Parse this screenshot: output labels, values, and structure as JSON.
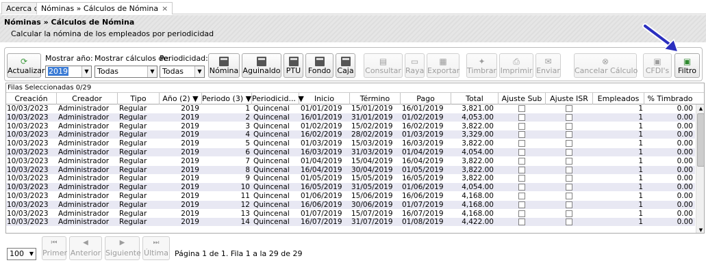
{
  "tabs": [
    {
      "label": "Acerca de"
    },
    {
      "label": "Nóminas » Cálculos de Nómina",
      "close": "×"
    }
  ],
  "header": {
    "title": "Nóminas » Cálculos de Nómina",
    "subtitle": "Calcular la nómina de los empleados por periodicidad"
  },
  "toolbar": {
    "refresh_label": "Actualizar",
    "year_label": "Mostrar año:",
    "year_value": "2019",
    "calc_label": "Mostrar cálculos de:",
    "calc_value": "Todas",
    "period_label": "Periodicidad:",
    "period_value": "Todas",
    "buttons": {
      "nomina": "Nómina",
      "aguinaldo": "Aguinaldo",
      "ptu": "PTU",
      "fondo": "Fondo",
      "caja": "Caja",
      "consultar": "Consultar",
      "raya": "Raya",
      "exportar": "Exportar",
      "timbrar": "Timbrar",
      "imprimir": "Imprimir",
      "enviar": "Enviar",
      "cancelar": "Cancelar Cálculo",
      "cfdis": "CFDI's",
      "filtro": "Filtro"
    }
  },
  "grid": {
    "selected_rows": "Filas Seleccionadas  0/29",
    "columns": [
      "Creación",
      "Creador",
      "Tipo",
      "Año (2) ▼",
      "Periodo (3) ▼",
      "Periodicid... ▼",
      "Inicio",
      "Término",
      "Pago",
      "Total",
      "Ajuste Sub",
      "Ajuste ISR",
      "Empleados",
      "% Timbrado"
    ],
    "rows": [
      [
        "10/03/2023",
        "Administrador",
        "Regular",
        "2019",
        "1",
        "Quincenal",
        "01/01/2019",
        "15/01/2019",
        "16/01/2019",
        "3,821.00",
        "1",
        "0.00"
      ],
      [
        "10/03/2023",
        "Administrador",
        "Regular",
        "2019",
        "2",
        "Quincenal",
        "16/01/2019",
        "31/01/2019",
        "01/02/2019",
        "4,053.00",
        "1",
        "0.00"
      ],
      [
        "10/03/2023",
        "Administrador",
        "Regular",
        "2019",
        "3",
        "Quincenal",
        "01/02/2019",
        "15/02/2019",
        "16/02/2019",
        "3,822.00",
        "1",
        "0.00"
      ],
      [
        "10/03/2023",
        "Administrador",
        "Regular",
        "2019",
        "4",
        "Quincenal",
        "16/02/2019",
        "28/02/2019",
        "01/03/2019",
        "3,329.00",
        "1",
        "0.00"
      ],
      [
        "10/03/2023",
        "Administrador",
        "Regular",
        "2019",
        "5",
        "Quincenal",
        "01/03/2019",
        "15/03/2019",
        "16/03/2019",
        "3,822.00",
        "1",
        "0.00"
      ],
      [
        "10/03/2023",
        "Administrador",
        "Regular",
        "2019",
        "6",
        "Quincenal",
        "16/03/2019",
        "31/03/2019",
        "01/04/2019",
        "4,054.00",
        "1",
        "0.00"
      ],
      [
        "10/03/2023",
        "Administrador",
        "Regular",
        "2019",
        "7",
        "Quincenal",
        "01/04/2019",
        "15/04/2019",
        "16/04/2019",
        "3,822.00",
        "1",
        "0.00"
      ],
      [
        "10/03/2023",
        "Administrador",
        "Regular",
        "2019",
        "8",
        "Quincenal",
        "16/04/2019",
        "30/04/2019",
        "01/05/2019",
        "3,822.00",
        "1",
        "0.00"
      ],
      [
        "10/03/2023",
        "Administrador",
        "Regular",
        "2019",
        "9",
        "Quincenal",
        "01/05/2019",
        "15/05/2019",
        "16/05/2019",
        "3,822.00",
        "1",
        "0.00"
      ],
      [
        "10/03/2023",
        "Administrador",
        "Regular",
        "2019",
        "10",
        "Quincenal",
        "16/05/2019",
        "31/05/2019",
        "01/06/2019",
        "4,054.00",
        "1",
        "0.00"
      ],
      [
        "10/03/2023",
        "Administrador",
        "Regular",
        "2019",
        "11",
        "Quincenal",
        "01/06/2019",
        "15/06/2019",
        "16/06/2019",
        "4,168.00",
        "1",
        "0.00"
      ],
      [
        "10/03/2023",
        "Administrador",
        "Regular",
        "2019",
        "12",
        "Quincenal",
        "16/06/2019",
        "30/06/2019",
        "01/07/2019",
        "4,168.00",
        "1",
        "0.00"
      ],
      [
        "10/03/2023",
        "Administrador",
        "Regular",
        "2019",
        "13",
        "Quincenal",
        "01/07/2019",
        "15/07/2019",
        "16/07/2019",
        "4,168.00",
        "1",
        "0.00"
      ],
      [
        "10/03/2023",
        "Administrador",
        "Regular",
        "2019",
        "14",
        "Quincenal",
        "16/07/2019",
        "31/07/2019",
        "01/08/2019",
        "4,422.00",
        "1",
        "0.00"
      ]
    ]
  },
  "pager": {
    "page_size": "100",
    "primer": "Primer",
    "anterior": "Anterior",
    "siguiente": "Siguiente",
    "ultima": "Última",
    "info": "Página 1 de 1. Fila 1 a la 29 de 29"
  }
}
